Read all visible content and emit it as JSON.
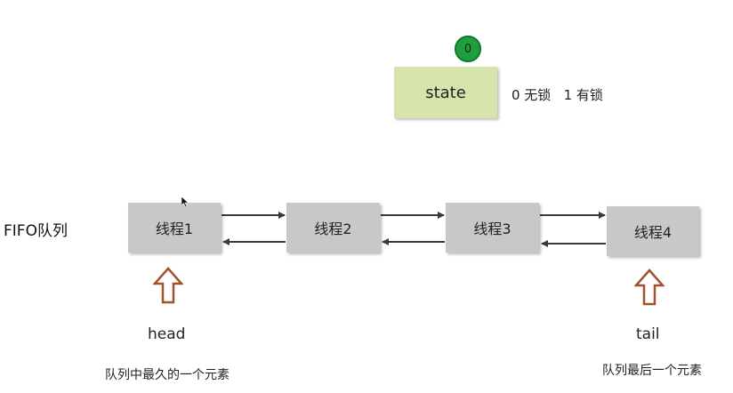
{
  "state": {
    "value_badge": "0",
    "box_label": "state",
    "legend": "0 无锁   1 有锁"
  },
  "queue": {
    "label": "FIFO队列",
    "nodes": [
      {
        "label": "线程1"
      },
      {
        "label": "线程2"
      },
      {
        "label": "线程3"
      },
      {
        "label": "线程4"
      }
    ]
  },
  "head": {
    "label": "head",
    "description": "队列中最久的一个元素"
  },
  "tail": {
    "label": "tail",
    "description": "队列最后一个元素"
  },
  "colors": {
    "state_box": "#d4e4ab",
    "state_badge": "#1f9d3f",
    "node_fill": "#c8c8c8",
    "pointer_arrow": "#a0522d",
    "link_arrow": "#3a3a3a"
  },
  "icons": {
    "pointer": "hollow-up-arrow-icon",
    "cursor": "mouse-cursor-icon"
  }
}
